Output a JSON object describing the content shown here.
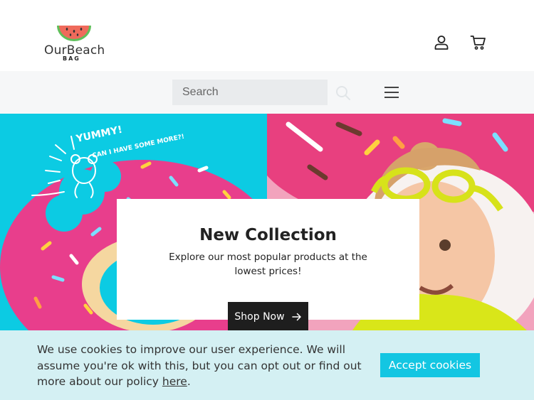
{
  "header": {
    "logo_text": "OurBeach",
    "logo_sub": "BAG",
    "icons": {
      "account": "user-icon",
      "cart": "cart-icon"
    }
  },
  "search": {
    "placeholder": "Search",
    "icons": {
      "search": "search-icon",
      "menu": "hamburger-menu-icon"
    }
  },
  "hero": {
    "image_text_line1": "YUMMY!",
    "image_text_line2": "CAN I HAVE SOME MORE?!",
    "title": "New Collection",
    "description": "Explore our most popular products at the lowest prices!",
    "cta_label": "Shop Now",
    "cta_icon": "arrow-right-icon"
  },
  "cookies": {
    "text": "We use cookies to improve our user experience. We will assume you're ok with this, but you can opt out or find out more about our policy ",
    "link_text": "here",
    "text_end": ".",
    "accept_label": "Accept cookies"
  },
  "colors": {
    "accent": "#13c6e2",
    "hero_left_bg": "#0ccbe3",
    "cookie_bg": "#d4f0f3",
    "button_dark": "#1e1e1e",
    "donut_pink": "#e83e8c"
  }
}
